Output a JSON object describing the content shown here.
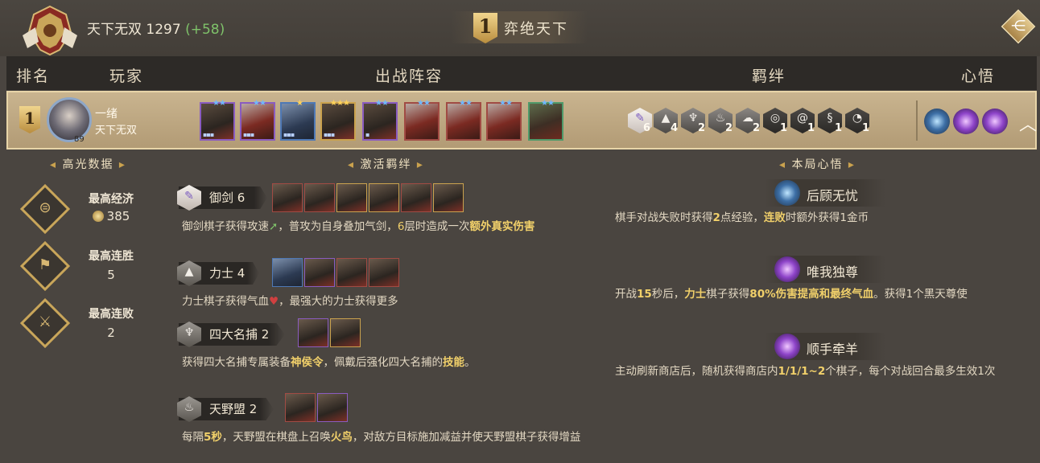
{
  "header": {
    "player_title": "天下无双",
    "score": "1297",
    "score_delta": "(+58)",
    "rank": "1",
    "rank_label": "弈绝天下"
  },
  "table_headers": [
    "排名",
    "玩家",
    "出战阵容",
    "羁绊",
    "心悟"
  ],
  "player": {
    "rank": "1",
    "name": "一绪",
    "title": "天下无双",
    "level": "89",
    "lineup": [
      {
        "stars": "★★",
        "star_color": "blue"
      },
      {
        "stars": "★★",
        "star_color": "blue"
      },
      {
        "stars": "★",
        "star_color": "gold"
      },
      {
        "stars": "★★★",
        "star_color": "gold"
      },
      {
        "stars": "★★",
        "star_color": "blue"
      },
      {
        "stars": "★★",
        "star_color": "blue"
      },
      {
        "stars": "★★",
        "star_color": "blue"
      },
      {
        "stars": "★★",
        "star_color": "blue"
      },
      {
        "stars": "★★",
        "star_color": "blue"
      }
    ],
    "bonds": [
      {
        "icon": "sword-icon",
        "count": "6"
      },
      {
        "icon": "mountain-icon",
        "count": "4"
      },
      {
        "icon": "blade-icon",
        "count": "2"
      },
      {
        "icon": "flame-icon",
        "count": "2"
      },
      {
        "icon": "cloud-icon",
        "count": "2"
      },
      {
        "icon": "spiral-icon",
        "count": "1"
      },
      {
        "icon": "swirl-icon",
        "count": "1"
      },
      {
        "icon": "dragon-icon",
        "count": "1"
      },
      {
        "icon": "vortex-icon",
        "count": "1"
      }
    ]
  },
  "highlights": {
    "title": "高光数据",
    "stats": [
      {
        "label": "最高经济",
        "value": "385"
      },
      {
        "label": "最高连胜",
        "value": "5"
      },
      {
        "label": "最高连败",
        "value": "2"
      }
    ]
  },
  "synergies": {
    "title": "激活羁绊",
    "items": [
      {
        "name": "御剑",
        "count": "6",
        "desc_plain": "御剑棋子获得攻速",
        "desc_mid": "，普攻为自身叠加气剑，",
        "desc_hl": "6",
        "desc_tail": "层时造成一次",
        "desc_bold": "额外真实伤害"
      },
      {
        "name": "力士",
        "count": "4",
        "desc": "力士棋子获得气血",
        "desc_tail": "，最强大的力士获得更多"
      },
      {
        "name": "四大名捕",
        "count": "2",
        "desc_a": "获得四大名捕专属装备",
        "desc_b": "神侯令",
        "desc_c": "，佩戴后强化四大名捕的",
        "desc_d": "技能",
        "desc_e": "。"
      },
      {
        "name": "天野盟",
        "count": "2",
        "desc_a": "每隔",
        "desc_b": "5秒",
        "desc_c": "，天野盟在棋盘上召唤",
        "desc_d": "火鸟",
        "desc_e": "，对敌方目标施加减益并使天野盟棋子获得增益"
      }
    ]
  },
  "augments": {
    "title": "本局心悟",
    "items": [
      {
        "name": "后顾无忧",
        "a": "棋手对战失败时获得",
        "b": "2",
        "c": "点经验，",
        "d": "连败",
        "e": "时额外获得1金币"
      },
      {
        "name": "唯我独尊",
        "a": "开战",
        "b": "15",
        "c": "秒后，",
        "d": "力士",
        "e": "棋子获得",
        "f": "80%伤害提高和最终气血",
        "g": "。获得1个黑天尊使"
      },
      {
        "name": "顺手牵羊",
        "a": "主动刷新商店后，随机获得商店内",
        "b": "1/1/1~2",
        "c": "个棋子，每个对战回合最多生效1次"
      }
    ]
  }
}
